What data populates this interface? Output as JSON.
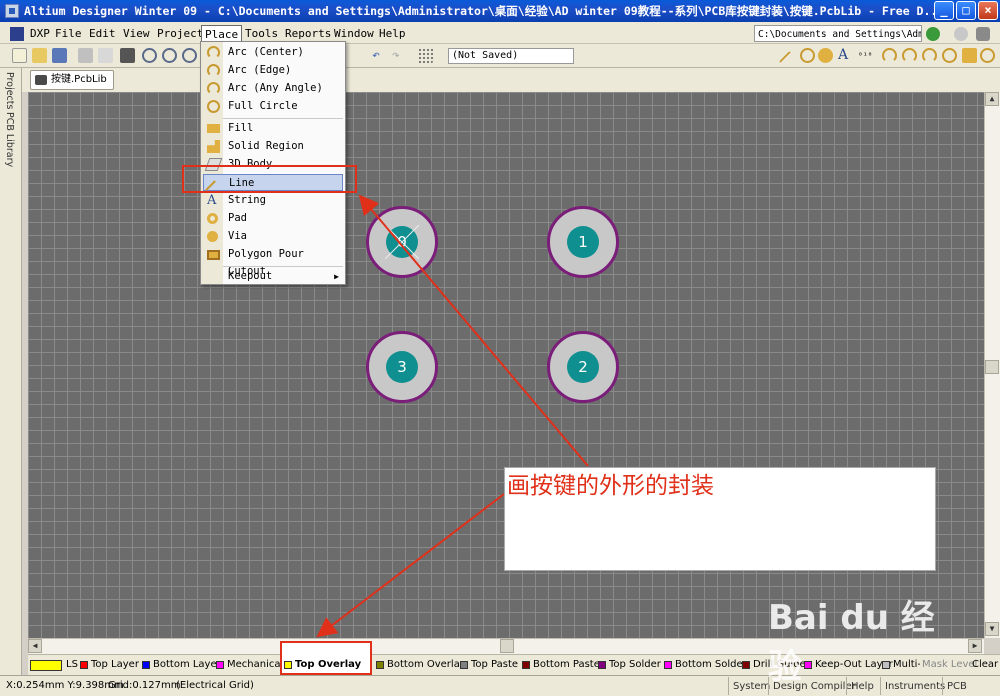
{
  "window": {
    "title": "Altium Designer Winter 09 - C:\\Documents and Settings\\Administrator\\桌面\\经验\\AD winter 09教程--系列\\PCB库按键封装\\按键.PcbLib - Free D...",
    "minimize": "_",
    "maximize": "□",
    "close": "×"
  },
  "menubar": {
    "items": [
      "DXP",
      "File",
      "Edit",
      "View",
      "Project",
      "Place",
      "Tools",
      "Reports",
      "Window",
      "Help"
    ],
    "path_box": "C:\\Documents and Settings\\Admir"
  },
  "toolbar": {
    "saved_state": "(Not Saved)"
  },
  "document": {
    "tab_label": "按键.PcbLib"
  },
  "side_panels": [
    "Projects",
    "PCB Library"
  ],
  "place_menu": {
    "items": [
      {
        "label": "Arc (Center)",
        "icon": "arc-center-icon"
      },
      {
        "label": "Arc (Edge)",
        "icon": "arc-edge-icon"
      },
      {
        "label": "Arc (Any Angle)",
        "icon": "arc-any-angle-icon"
      },
      {
        "label": "Full Circle",
        "icon": "full-circle-icon"
      },
      {
        "label": "Fill",
        "icon": "fill-icon"
      },
      {
        "label": "Solid Region",
        "icon": "solid-region-icon"
      },
      {
        "label": "3D Body",
        "icon": "3d-body-icon"
      },
      {
        "label": "Line",
        "icon": "line-icon"
      },
      {
        "label": "String",
        "icon": "string-icon"
      },
      {
        "label": "Pad",
        "icon": "pad-icon"
      },
      {
        "label": "Via",
        "icon": "via-icon"
      },
      {
        "label": "Polygon Pour Cutout",
        "icon": "polygon-cutout-icon"
      },
      {
        "label": "Keepout",
        "icon": "submenu-arrow-icon"
      }
    ]
  },
  "pads": [
    "0",
    "1",
    "3",
    "2"
  ],
  "annotation": {
    "text": "画按键的外形的封装",
    "color": "#e0301a"
  },
  "layers": [
    {
      "label": "LS",
      "color": "#ffff00"
    },
    {
      "label": "Top Layer",
      "color": "#ff0000"
    },
    {
      "label": "Bottom Layer",
      "color": "#0000ff"
    },
    {
      "label": "Mechanical",
      "color": "#ff00ff"
    },
    {
      "label": "Top Overlay",
      "color": "#ffff00"
    },
    {
      "label": "Bottom Overlay",
      "color": "#808000"
    },
    {
      "label": "Top Paste",
      "color": "#808080"
    },
    {
      "label": "Bottom Paste",
      "color": "#800000"
    },
    {
      "label": "Top Solder",
      "color": "#800080"
    },
    {
      "label": "Bottom Solder",
      "color": "#ff00ff"
    },
    {
      "label": "Drill Guide",
      "color": "#800000"
    },
    {
      "label": "Keep-Out Layer",
      "color": "#ff00ff"
    },
    {
      "label": "Multi-Layer",
      "color": "#c0c0c0"
    },
    {
      "label": "Mask Level",
      "color": "#808080"
    },
    {
      "label": "Clear",
      "color": "#ece9d8"
    }
  ],
  "status": {
    "coords": "X:0.254mm Y:9.398mm",
    "grid": "Grid:0.127mm",
    "mode": "(Electrical Grid)",
    "buttons": [
      "System",
      "Design Compiler",
      "Help",
      "Instruments",
      "PCB"
    ]
  },
  "watermark": "Bai du 经验",
  "colors": {
    "canvas": "#6c6c6c",
    "pad_ring": "#7a1e7a",
    "pad_hole": "#0f8f8f",
    "highlight": "#e0301a"
  }
}
